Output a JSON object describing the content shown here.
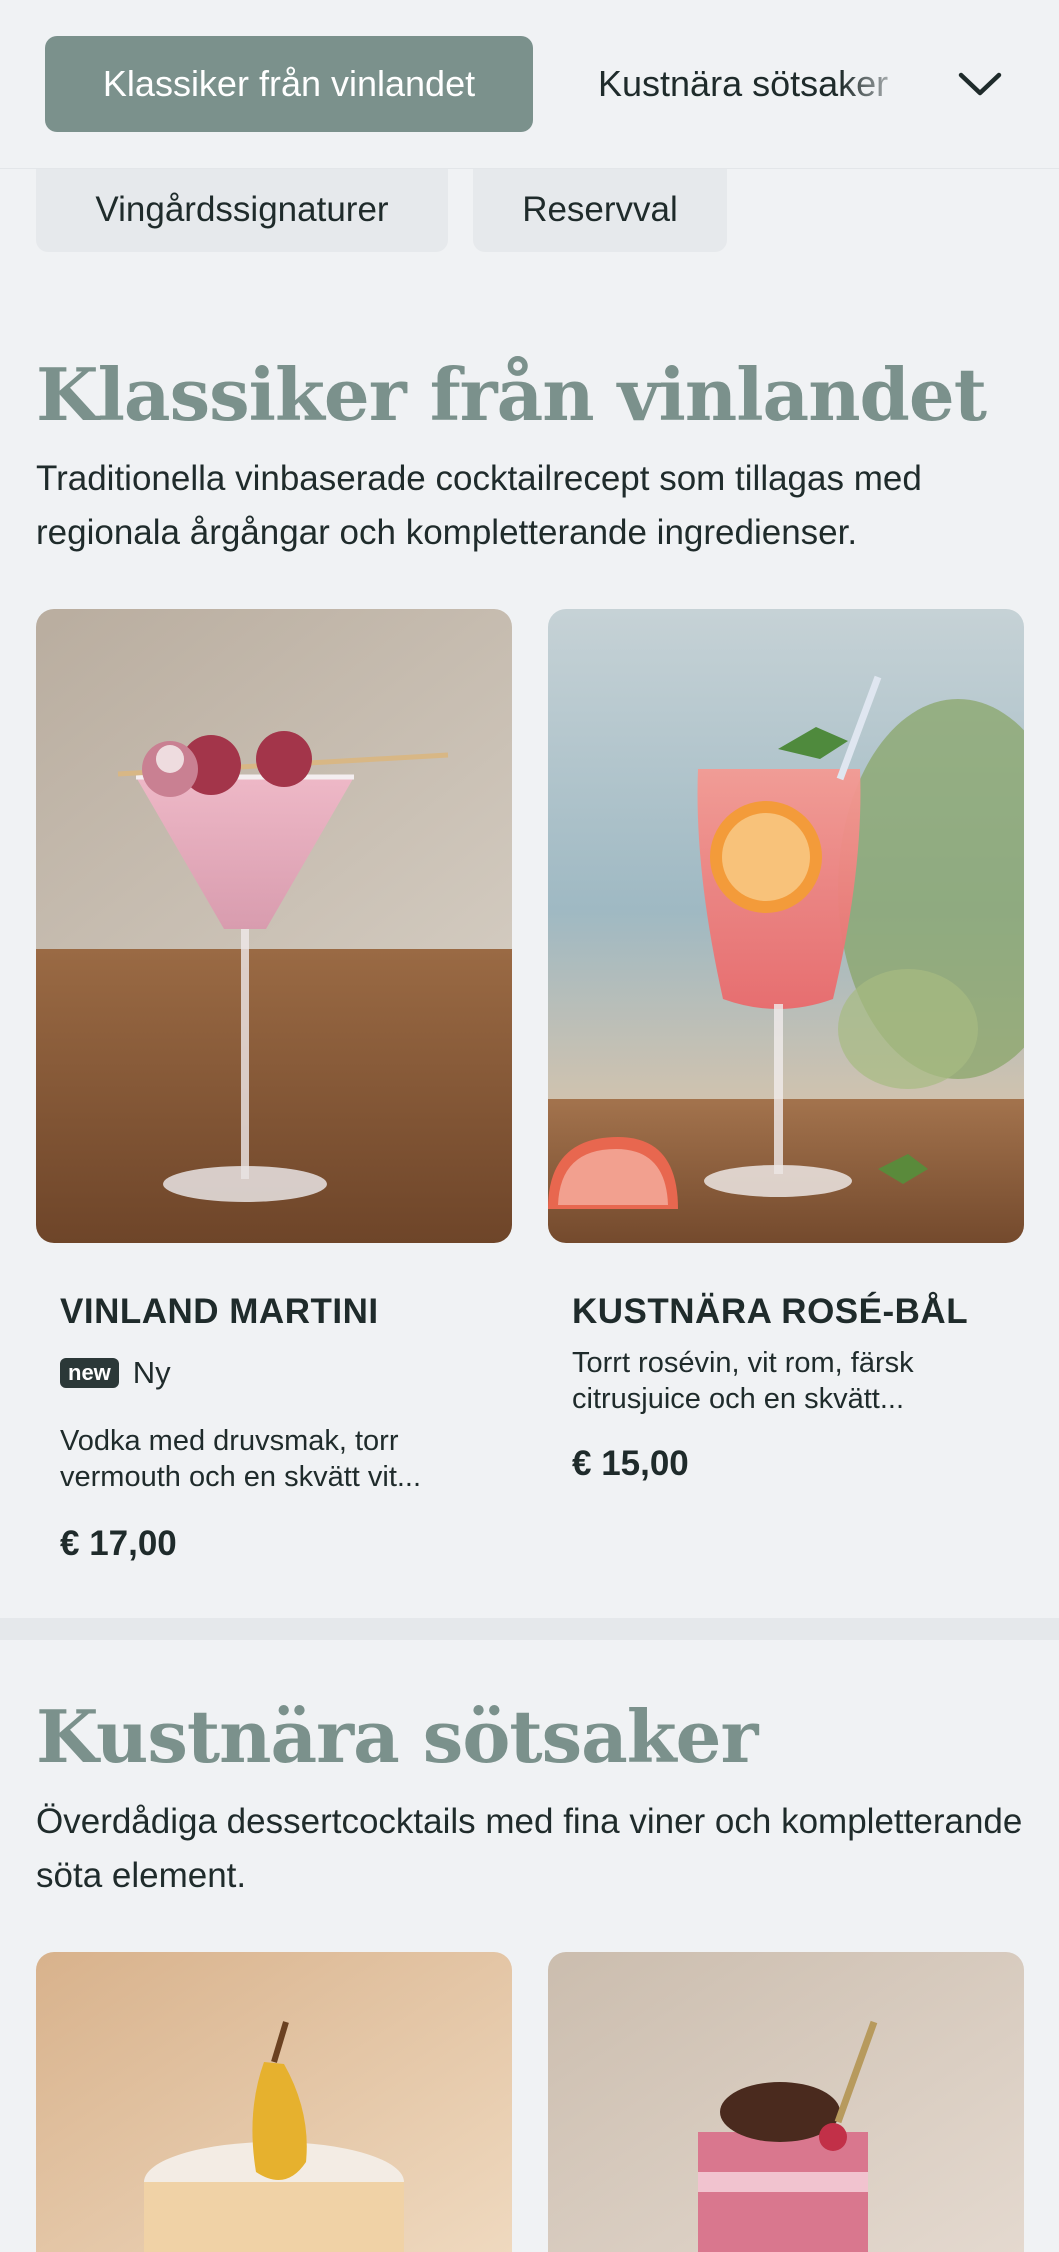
{
  "nav": {
    "active_tab": "Klassiker från vinlandet",
    "next_tab": "Kustnära sötsaker",
    "subtabs": [
      "Vingårdssignaturer",
      "Reservval"
    ]
  },
  "sections": [
    {
      "title": "Klassiker från vinlandet",
      "description": "Traditionella vinbaserade cocktailrecept som tillagas med regionala årgångar och kompletterande ingredienser.",
      "items": [
        {
          "name": "VINLAND MARTINI",
          "badge": "new",
          "badge_label": "Ny",
          "description": "Vodka med druvsmak, torr vermouth och en skvätt vit...",
          "price": "€ 17,00"
        },
        {
          "name": "KUSTNÄRA ROSÉ-BÅL",
          "description": "Torrt rosévin, vit rom, färsk citrusjuice och en skvätt...",
          "price": "€ 15,00"
        }
      ]
    },
    {
      "title": "Kustnära sötsaker",
      "description": "Överdådiga dessertcocktails med fina viner och kompletterande söta element."
    }
  ],
  "colors": {
    "accent": "#7b918c",
    "background": "#f0f2f4",
    "text": "#1f2b2b"
  },
  "icons": {
    "nav_toggle": "chevron-down-icon"
  }
}
